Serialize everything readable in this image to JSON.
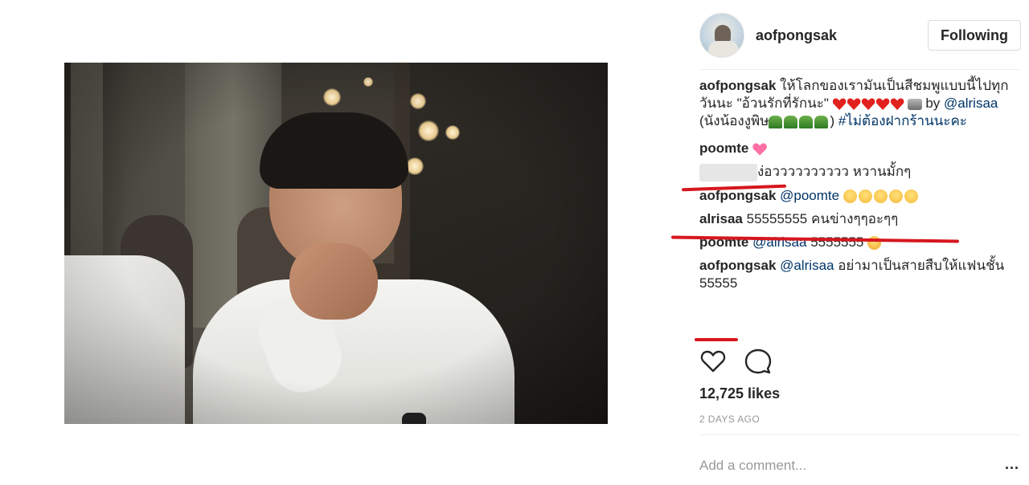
{
  "post": {
    "username": "aofpongsak",
    "follow_label": "Following",
    "caption": {
      "user": "aofpongsak",
      "text1": "ให้โลกของเรามันเป็นสีชมพูแบบนี้ไปทุกวันนะ \"อ้วนรักที่รักนะ\" ",
      "text2": " by ",
      "mention": "@alrisaa",
      "text3": " (นังน้องงูพิษ",
      "text4": ") ",
      "hashtag": "#ไม่ต้องฝากร้านนะคะ"
    },
    "comments": [
      {
        "user": "poomte",
        "text": ""
      },
      {
        "user": "",
        "text": "ง่อวววววววววว หวานมั้กๆ"
      },
      {
        "user": "aofpongsak",
        "mention": "@poomte",
        "text": ""
      },
      {
        "user": "alrisaa",
        "text": "55555555 คนข่างๆๆอะๆๆ"
      },
      {
        "user": "poomte",
        "mention": "@alrisaa",
        "text": "5555555"
      },
      {
        "user": "aofpongsak",
        "mention": "@alrisaa",
        "text": "อย่ามาเป็นสายสืบให้แฟนชั้น 55555"
      }
    ],
    "likes": "12,725 likes",
    "time": "2 DAYS AGO",
    "add_comment_placeholder": "Add a comment...",
    "more": "..."
  },
  "icons": {
    "like": "heart-outline-icon",
    "comment": "speech-bubble-icon"
  },
  "colors": {
    "mention": "#003569",
    "annotation_red": "#d6171f",
    "muted": "#999999"
  }
}
